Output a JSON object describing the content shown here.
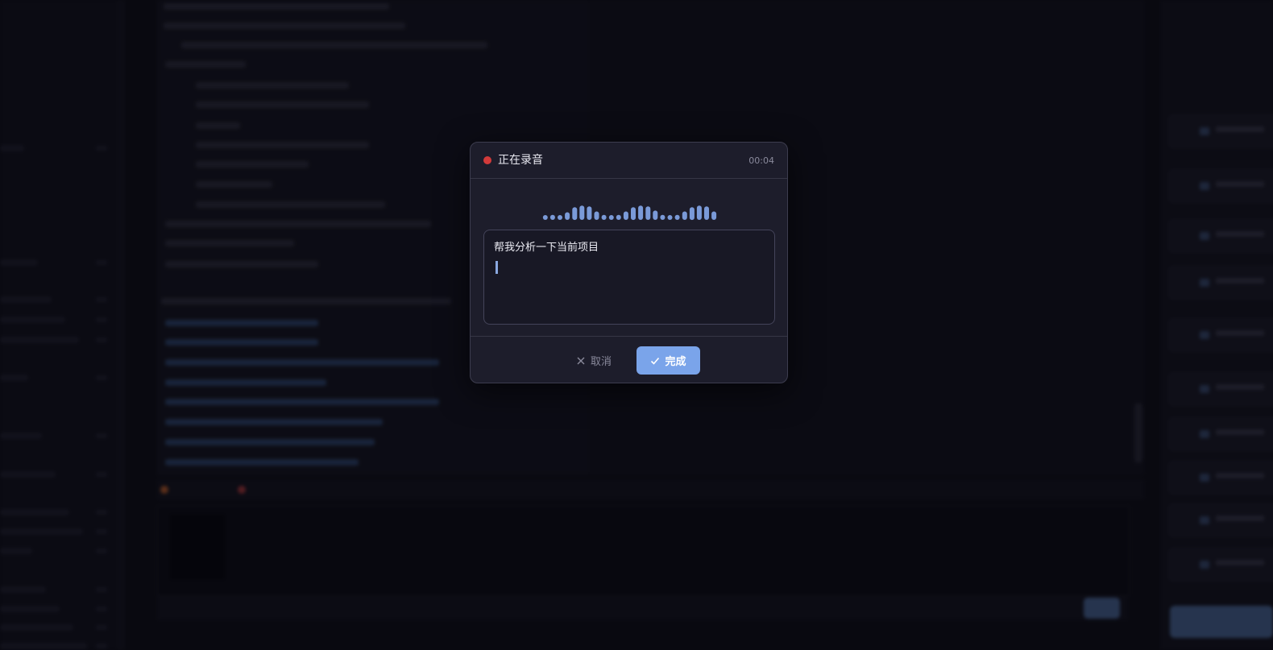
{
  "recording_dialog": {
    "status_title": "正在录音",
    "elapsed_time": "00:04",
    "transcript_text": "帮我分析一下当前项目",
    "cancel_label": "取消",
    "done_label": "完成",
    "cancel_icon": "close-icon",
    "done_icon": "check-icon",
    "waveform_levels": [
      0.2,
      0.3,
      0.2,
      0.45,
      0.75,
      0.85,
      0.8,
      0.5,
      0.3,
      0.2,
      0.3,
      0.5,
      0.75,
      0.85,
      0.8,
      0.55,
      0.3,
      0.2,
      0.3,
      0.5,
      0.75,
      0.85,
      0.8,
      0.5
    ]
  },
  "colors": {
    "accent": "#7aa4ea",
    "recording_dot": "#d23a3a",
    "waveform": "#7a9ad8"
  }
}
